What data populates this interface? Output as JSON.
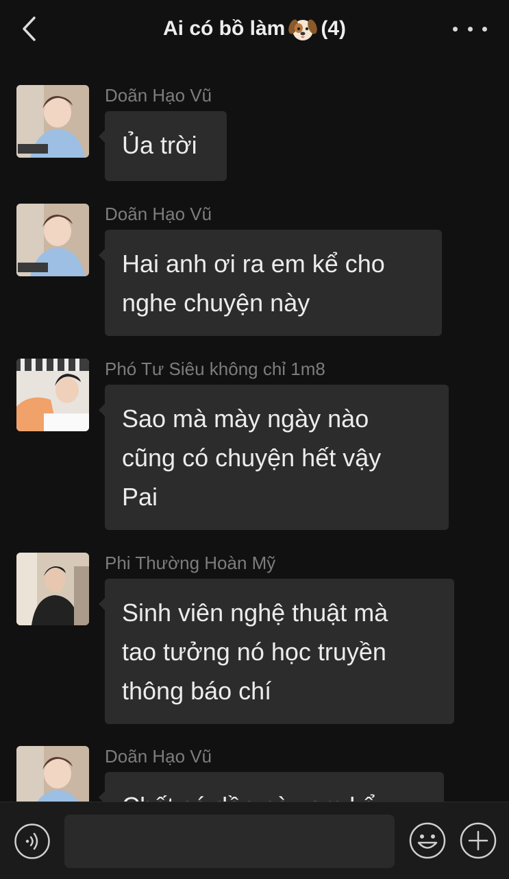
{
  "header": {
    "back_icon": "chevron-left-icon",
    "title_text": "Ai có bồ làm",
    "title_emoji": "dog-face-icon",
    "member_count": "(4)",
    "more_icon": "ellipsis-icon"
  },
  "messages": [
    {
      "sender": "Doãn Hạo Vũ",
      "lines": [
        "Ủa trời"
      ]
    },
    {
      "sender": "Doãn Hạo Vũ",
      "lines": [
        "Hai anh ơi ra em kể cho",
        "nghe chuyện này"
      ]
    },
    {
      "sender": "Phó Tư Siêu không chỉ 1m8",
      "lines": [
        "Sao mà mày ngày nào",
        "cũng có chuyện hết vậy",
        "Pai"
      ]
    },
    {
      "sender": "Phi Thường Hoàn Mỹ",
      "lines": [
        "Sinh viên nghệ thuật mà",
        "tao tưởng nó học truyền",
        "thông báo chí"
      ]
    },
    {
      "sender": "Doãn Hạo Vũ",
      "lines": [
        "Chết có dần này em kể"
      ]
    }
  ],
  "footer": {
    "voice_icon": "voice-input-icon",
    "emoji_icon": "smiley-icon",
    "plus_icon": "plus-circle-icon"
  }
}
